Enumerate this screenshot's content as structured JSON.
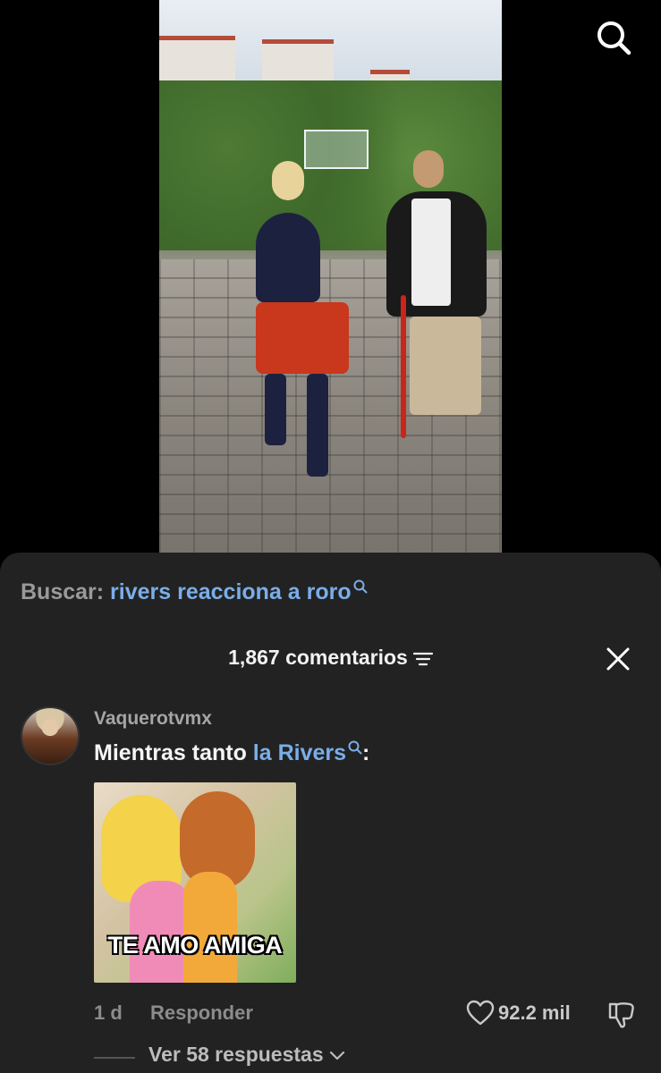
{
  "search": {
    "label": "Buscar:",
    "term": "rivers reacciona a roro"
  },
  "comments_header": {
    "count_label": "1,867 comentarios"
  },
  "comment": {
    "username": "Vaquerotvmx",
    "text_prefix": "Mientras tanto ",
    "text_link": "la Rivers",
    "text_suffix": ":",
    "image_caption": "TE AMO AMIGA",
    "time": "1 d",
    "reply_label": "Responder",
    "likes": "92.2 mil",
    "replies_label": "Ver 58 respuestas"
  },
  "icons": {
    "search": "search-icon",
    "filter": "filter-icon",
    "close": "close-icon",
    "heart": "heart-icon",
    "dislike": "thumbs-down-icon",
    "chevron": "chevron-down-icon"
  },
  "colors": {
    "link": "#7aaee9",
    "sheet_bg": "#222222",
    "muted": "#8c8c8c"
  }
}
